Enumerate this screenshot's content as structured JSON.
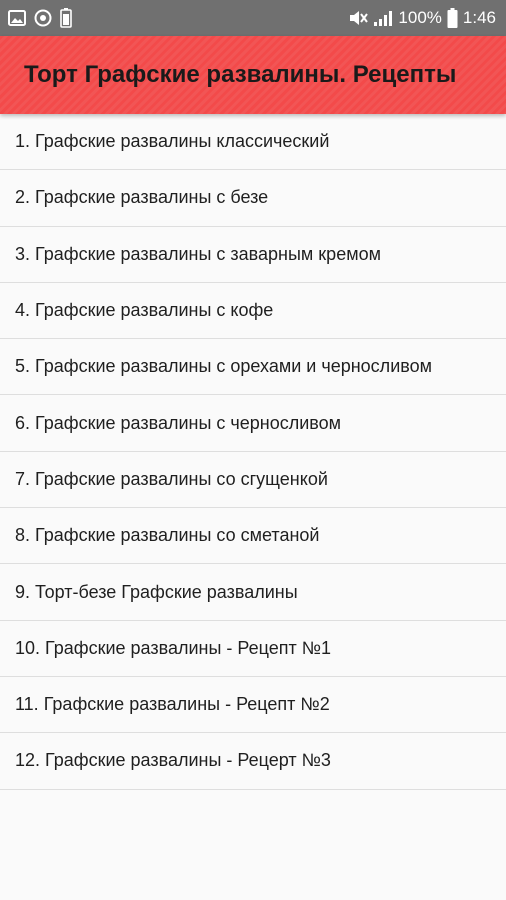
{
  "status_bar": {
    "left_icons": [
      "image-icon",
      "target-icon",
      "battery-saver-icon"
    ],
    "right_icons": [
      "mute-icon",
      "signal-icon",
      "battery-icon"
    ],
    "battery_percent": "100%",
    "time": "1:46"
  },
  "app_bar": {
    "title": "Торт Графские развалины. Рецепты",
    "color": "#f34a4a"
  },
  "list": {
    "items": [
      {
        "label": "1. Графские развалины классический"
      },
      {
        "label": "2. Графские развалины с безе"
      },
      {
        "label": "3. Графские развалины с заварным кремом"
      },
      {
        "label": "4. Графские развалины с кофе"
      },
      {
        "label": "5. Графские развалины с орехами и черносливом"
      },
      {
        "label": "6. Графские развалины с черносливом"
      },
      {
        "label": "7. Графские развалины со сгущенкой"
      },
      {
        "label": "8. Графские развалины со сметаной"
      },
      {
        "label": "9. Торт-безе Графские развалины"
      },
      {
        "label": "10. Графские развалины - Рецепт №1"
      },
      {
        "label": "11. Графские развалины - Рецепт №2"
      },
      {
        "label": "12. Графские развалины - Рецерт №3"
      }
    ]
  }
}
